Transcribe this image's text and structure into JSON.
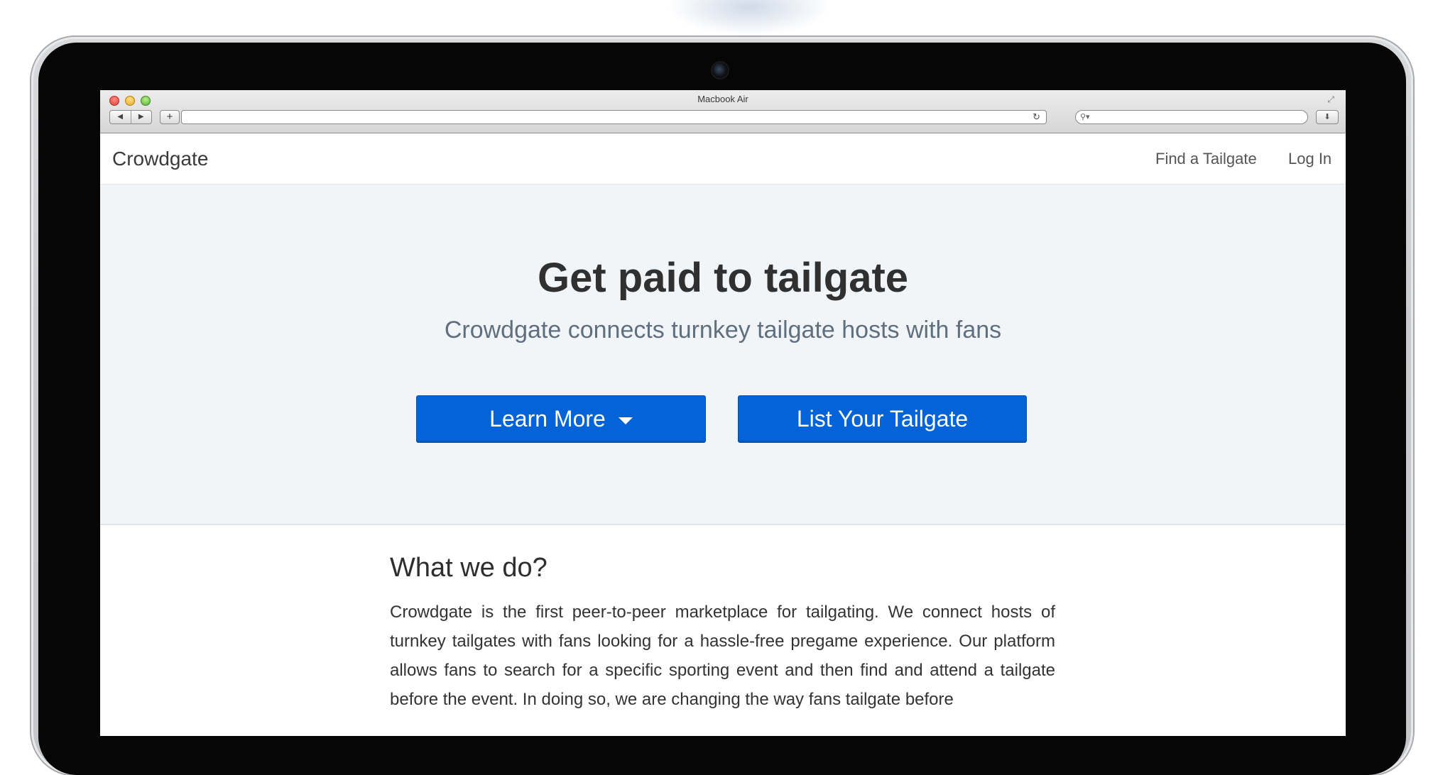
{
  "browser": {
    "window_title": "Macbook Air",
    "back_icon": "back-arrow-icon",
    "forward_icon": "forward-arrow-icon",
    "new_tab_label": "+",
    "address_value": "",
    "search_value": ""
  },
  "navbar": {
    "brand": "Crowdgate",
    "links": [
      "Find a Tailgate",
      "Log In"
    ]
  },
  "hero": {
    "title": "Get paid to tailgate",
    "subtitle": "Crowdgate connects turnkey tailgate hosts with fans",
    "learn_more_label": "Learn More",
    "list_label": "List Your Tailgate",
    "button_color": "#0463d6"
  },
  "about": {
    "heading": "What we do?",
    "body": "Crowdgate is the first peer-to-peer marketplace for tailgating. We connect hosts of turnkey tailgates with fans looking for a hassle-free pregame experience. Our platform allows fans to search for a specific sporting event and then find and attend a tailgate before the event. In doing so, we are changing the way fans tailgate before"
  }
}
